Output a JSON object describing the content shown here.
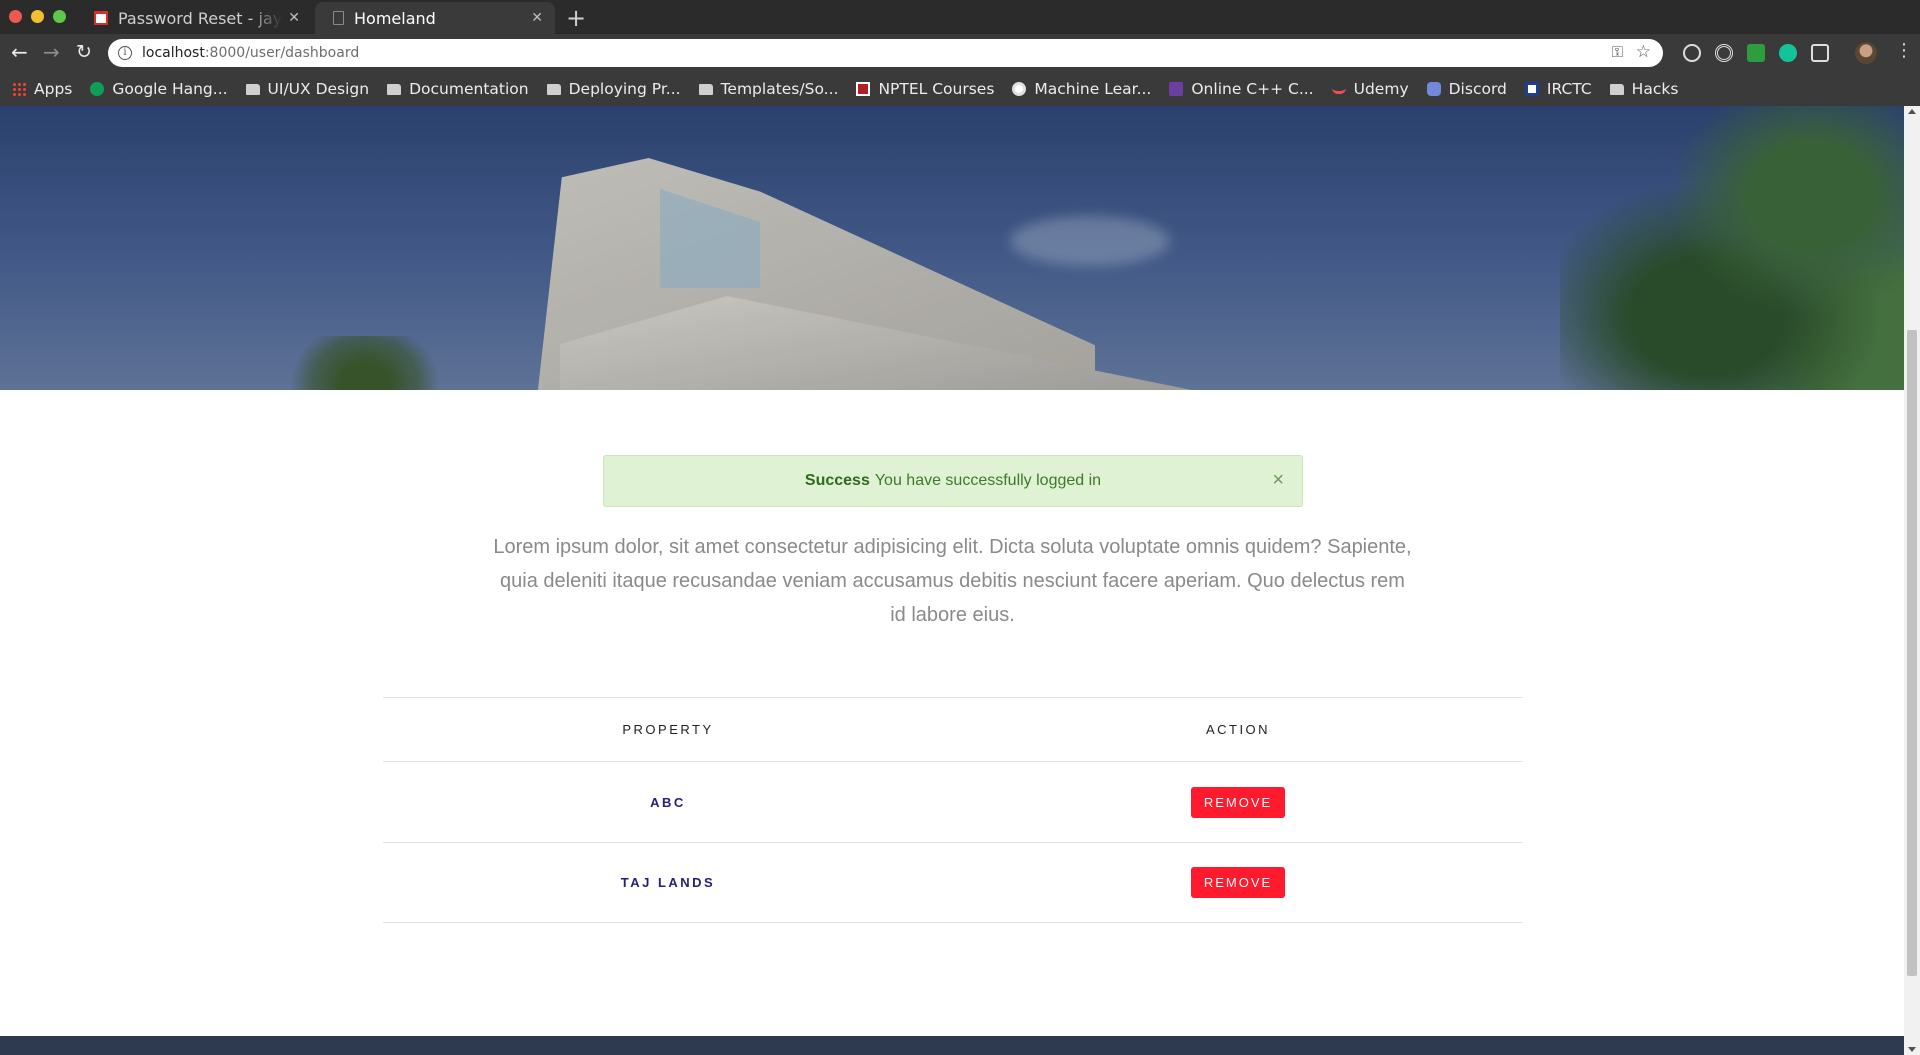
{
  "browser": {
    "tabs": [
      {
        "title": "Password Reset - jaygala",
        "icon": "gmail-icon",
        "active": false
      },
      {
        "title": "Homeland",
        "icon": "document-icon",
        "active": true
      }
    ],
    "close_glyph": "✕",
    "new_tab_glyph": "+",
    "url": {
      "host": "localhost",
      "path": ":8000/user/dashboard"
    },
    "bookmarks": [
      {
        "label": "Apps",
        "icon": "apps-grid-icon"
      },
      {
        "label": "Google Hang...",
        "icon": "hangouts-icon"
      },
      {
        "label": "UI/UX Design",
        "icon": "folder-icon"
      },
      {
        "label": "Documentation",
        "icon": "folder-icon"
      },
      {
        "label": "Deploying Pr...",
        "icon": "folder-icon"
      },
      {
        "label": "Templates/So...",
        "icon": "folder-icon"
      },
      {
        "label": "NPTEL Courses",
        "icon": "nptel-icon"
      },
      {
        "label": "Machine Lear...",
        "icon": "ml-icon"
      },
      {
        "label": "Online C++ C...",
        "icon": "cpp-icon"
      },
      {
        "label": "Udemy",
        "icon": "udemy-icon"
      },
      {
        "label": "Discord",
        "icon": "discord-icon"
      },
      {
        "label": "IRCTC",
        "icon": "irctc-icon"
      },
      {
        "label": "Hacks",
        "icon": "folder-icon"
      }
    ]
  },
  "page": {
    "alert": {
      "strong": "Success",
      "message": "You have successfully logged in",
      "close": "×",
      "color": "#dff2d3"
    },
    "intro": "Lorem ipsum dolor, sit amet consectetur adipisicing elit. Dicta soluta voluptate omnis quidem? Sapiente, quia deleniti itaque recusandae veniam accusamus debitis nesciunt facere aperiam. Quo delectus rem id labore eius.",
    "table": {
      "headers": [
        "PROPERTY",
        "ACTION"
      ],
      "rows": [
        {
          "property": "ABC",
          "action": "REMOVE"
        },
        {
          "property": "TAJ LANDS",
          "action": "REMOVE"
        }
      ]
    },
    "colors": {
      "remove_button": "#ff1a2e",
      "property_text": "#241f78",
      "footer": "#2d3a4f"
    }
  }
}
